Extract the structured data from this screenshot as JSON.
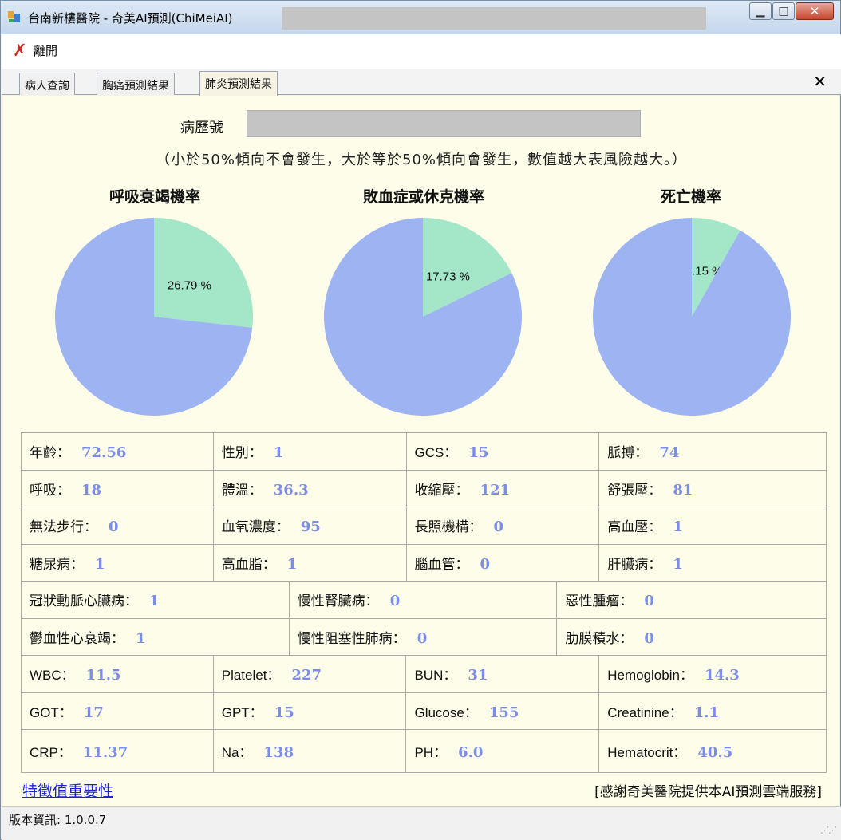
{
  "window": {
    "title": "台南新樓醫院 - 奇美AI預測(ChiMeiAI)",
    "buttons": {
      "minimize": "▁",
      "maximize": "□",
      "close": "✕"
    }
  },
  "menu": {
    "leave_label": "離開",
    "leave_icon": "close-x-icon"
  },
  "tabs": [
    {
      "label": "病人查詢",
      "active": false
    },
    {
      "label": "胸痛預測結果",
      "active": false
    },
    {
      "label": "肺炎預測結果",
      "active": true
    }
  ],
  "tab_close": "✕",
  "record": {
    "label": "病歷號",
    "value": ""
  },
  "hint": "（小於50%傾向不會發生，大於等於50%傾向會發生，數值越大表風險越大。）",
  "charts": {
    "resp": {
      "title": "呼吸衰竭機率",
      "label": "26.79 %"
    },
    "sepsis": {
      "title": "敗血症或休克機率",
      "label": "17.73 %"
    },
    "death": {
      "title": "死亡機率",
      "label": "8.15 %"
    }
  },
  "chart_data": [
    {
      "type": "pie",
      "title": "呼吸衰竭機率",
      "values": [
        26.79,
        73.21
      ],
      "labels": [
        "26.79 %",
        ""
      ],
      "colors": [
        "#a3e6c8",
        "#9db3f2"
      ]
    },
    {
      "type": "pie",
      "title": "敗血症或休克機率",
      "values": [
        17.73,
        82.27
      ],
      "labels": [
        "17.73 %",
        ""
      ],
      "colors": [
        "#a3e6c8",
        "#9db3f2"
      ]
    },
    {
      "type": "pie",
      "title": "死亡機率",
      "values": [
        8.15,
        91.85
      ],
      "labels": [
        "8.15 %",
        ""
      ],
      "colors": [
        "#a3e6c8",
        "#9db3f2"
      ]
    }
  ],
  "rows4a": [
    [
      {
        "l": "年齡：",
        "v": "72.56"
      },
      {
        "l": "性別：",
        "v": "1"
      },
      {
        "l": "GCS：",
        "v": "15"
      },
      {
        "l": "脈搏：",
        "v": "74"
      }
    ],
    [
      {
        "l": "呼吸：",
        "v": "18"
      },
      {
        "l": "體溫：",
        "v": "36.3"
      },
      {
        "l": "收縮壓：",
        "v": "121"
      },
      {
        "l": "舒張壓：",
        "v": "81"
      }
    ],
    [
      {
        "l": "無法步行：",
        "v": "0"
      },
      {
        "l": "血氧濃度：",
        "v": "95"
      },
      {
        "l": "長照機構：",
        "v": "0"
      },
      {
        "l": "高血壓：",
        "v": "1"
      }
    ],
    [
      {
        "l": "糖尿病：",
        "v": "1"
      },
      {
        "l": "高血脂：",
        "v": "1"
      },
      {
        "l": "腦血管：",
        "v": "0"
      },
      {
        "l": "肝臟病：",
        "v": "1"
      }
    ]
  ],
  "rows3": [
    [
      {
        "l": "冠狀動脈心臟病：",
        "v": "1"
      },
      {
        "l": "慢性腎臟病：",
        "v": "0"
      },
      {
        "l": "惡性腫瘤：",
        "v": "0"
      }
    ],
    [
      {
        "l": "鬱血性心衰竭：",
        "v": "1"
      },
      {
        "l": "慢性阻塞性肺病：",
        "v": "0"
      },
      {
        "l": "肋膜積水：",
        "v": "0"
      }
    ]
  ],
  "rows4b": [
    [
      {
        "l": "WBC：",
        "v": "11.5"
      },
      {
        "l": "Platelet：",
        "v": "227"
      },
      {
        "l": "BUN：",
        "v": "31"
      },
      {
        "l": "Hemoglobin：",
        "v": "14.3"
      }
    ],
    [
      {
        "l": "GOT：",
        "v": "17"
      },
      {
        "l": "GPT：",
        "v": "15"
      },
      {
        "l": "Glucose：",
        "v": "155"
      },
      {
        "l": "Creatinine：",
        "v": "1.1"
      }
    ],
    [
      {
        "l": "CRP：",
        "v": "11.37"
      },
      {
        "l": "Na：",
        "v": "138"
      },
      {
        "l": "PH：",
        "v": "6.0"
      },
      {
        "l": "Hematocrit：",
        "v": "40.5"
      }
    ]
  ],
  "footer": {
    "link": "特徵值重要性",
    "credit": "[感謝奇美醫院提供本AI預測雲端服務]"
  },
  "status": {
    "version": "版本資訊: 1.0.0.7"
  },
  "colors": {
    "slice": "#a3e6c8",
    "rest": "#9db3f2",
    "value": "#7b8de8",
    "link": "#1a22d8"
  }
}
